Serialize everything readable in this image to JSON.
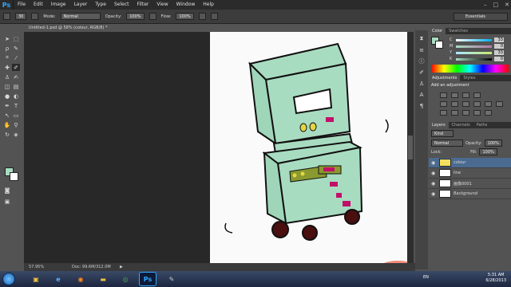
{
  "app": {
    "logo": "Ps"
  },
  "menu": [
    "File",
    "Edit",
    "Image",
    "Layer",
    "Type",
    "Select",
    "Filter",
    "View",
    "Window",
    "Help"
  ],
  "window_controls": [
    "–",
    "□",
    "✕"
  ],
  "options": {
    "brush_size": "30",
    "mode_label": "Mode:",
    "mode_value": "Normal",
    "opacity_label": "Opacity:",
    "opacity_value": "100%",
    "flow_label": "Flow:",
    "flow_value": "100%",
    "workspace": "Essentials"
  },
  "document": {
    "tab_title": "Untitled-1.psd @ 58% (colour, RGB/8) *",
    "zoom": "57.95%",
    "doc_info": "Doc: 99.6M/312.0M"
  },
  "colors": {
    "foreground": "#a8dcc0",
    "background": "#ffffff",
    "robot_fill": "#a8dcc0",
    "accent_magenta": "#c2106a"
  },
  "color_panel": {
    "tabs": [
      "Color",
      "Swatches"
    ],
    "sliders": [
      {
        "label": "C",
        "value": "33"
      },
      {
        "label": "M",
        "value": "0"
      },
      {
        "label": "Y",
        "value": "33"
      },
      {
        "label": "K",
        "value": "0"
      }
    ]
  },
  "adjustments": {
    "tabs": [
      "Adjustments",
      "Styles"
    ],
    "title": "Add an adjustment"
  },
  "layers_panel": {
    "tabs": [
      "Layers",
      "Channels",
      "Paths"
    ],
    "kind": "Kind",
    "blend": "Normal",
    "opacity_label": "Opacity:",
    "opacity_value": "100%",
    "lock_label": "Lock:",
    "fill_label": "Fill:",
    "fill_value": "100%",
    "layers": [
      {
        "name": "colour",
        "selected": true
      },
      {
        "name": "line",
        "selected": false
      },
      {
        "name": "画像0001",
        "selected": false
      },
      {
        "name": "Background",
        "selected": false
      }
    ]
  },
  "taskbar": {
    "lang": "EN",
    "time": "5:31 AM",
    "date": "6/28/2013"
  }
}
